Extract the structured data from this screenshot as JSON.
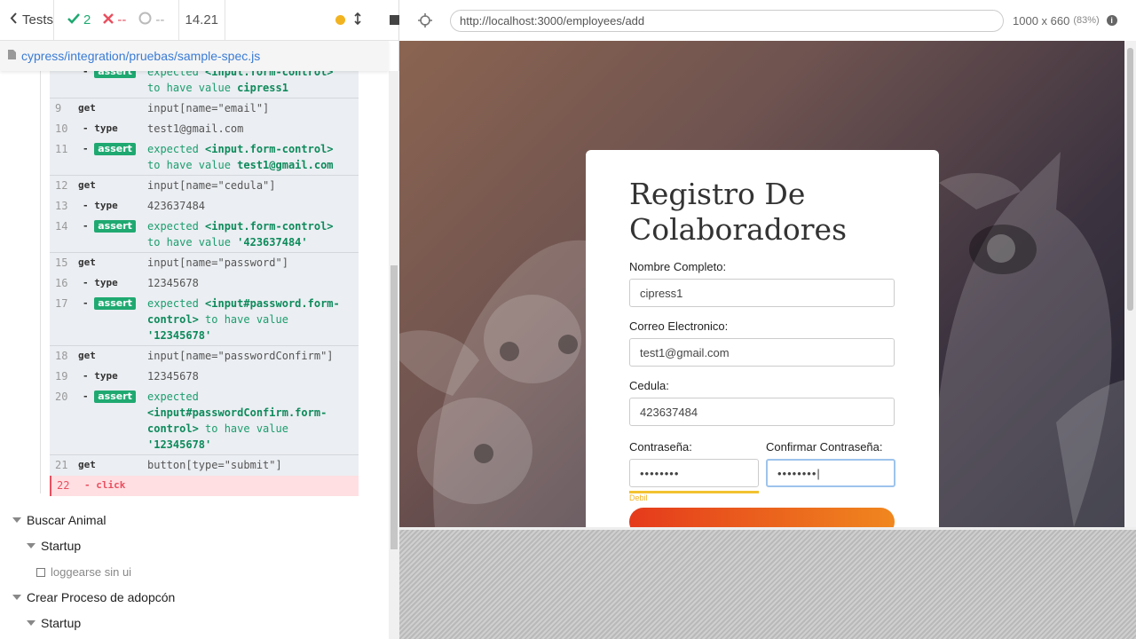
{
  "topbar": {
    "tests_label": "Tests",
    "passed": "2",
    "failed": "--",
    "pending": "--",
    "duration": "14.21"
  },
  "spec": {
    "file": "cypress/integration/pruebas/sample-spec.js"
  },
  "commands": [
    {
      "num": "",
      "name": "- assert",
      "badge": true,
      "msg_html": "<span class='g'>expected</span> <span class='gb'>&lt;input.form-control&gt;</span><br><span class='g'>to have value</span> <span class='gb'>cipress1</span>"
    },
    {
      "num": "9",
      "name": "get",
      "msg": "input[name=\"email\"]"
    },
    {
      "num": "10",
      "name": "- type",
      "msg": "test1@gmail.com"
    },
    {
      "num": "11",
      "name": "- assert",
      "badge": true,
      "expected": "<input.form-control>",
      "value": "test1@gmail.com"
    },
    {
      "num": "12",
      "name": "get",
      "msg": "input[name=\"cedula\"]"
    },
    {
      "num": "13",
      "name": "- type",
      "msg": "423637484"
    },
    {
      "num": "14",
      "name": "- assert",
      "badge": true,
      "expected": "<input.form-control>",
      "value": "'423637484'"
    },
    {
      "num": "15",
      "name": "get",
      "msg": "input[name=\"password\"]"
    },
    {
      "num": "16",
      "name": "- type",
      "msg": "12345678"
    },
    {
      "num": "17",
      "name": "- assert",
      "badge": true,
      "expected": "<input#password.form-control>",
      "value": "'12345678'"
    },
    {
      "num": "18",
      "name": "get",
      "msg": "input[name=\"passwordConfirm\"]"
    },
    {
      "num": "19",
      "name": "- type",
      "msg": "12345678"
    },
    {
      "num": "20",
      "name": "- assert",
      "badge": true,
      "expected": "<input#passwordConfirm.form-control>",
      "value": "'12345678'"
    },
    {
      "num": "21",
      "name": "get",
      "msg": "button[type=\"submit\"]"
    },
    {
      "num": "22",
      "name": "- click",
      "msg": "",
      "failed": true
    }
  ],
  "suites": {
    "buscar": "Buscar Animal",
    "startup1": "Startup",
    "test1": "loggearse sin ui",
    "crear": "Crear Proceso de adopcón",
    "startup2": "Startup"
  },
  "aut": {
    "url": "http://localhost:3000/employees/add",
    "viewport": "1000 x 660",
    "zoom": "(83%)"
  },
  "form": {
    "title": "Registro De Colaboradores",
    "nombre_label": "Nombre Completo:",
    "nombre_value": "cipress1",
    "correo_label": "Correo Electronico:",
    "correo_value": "test1@gmail.com",
    "cedula_label": "Cedula:",
    "cedula_value": "423637484",
    "pass_label": "Contraseña:",
    "pass_value": "••••••••",
    "confirm_label": "Confirmar Contraseña:",
    "confirm_value": "••••••••|",
    "strength": "Debil"
  },
  "colors": {
    "pass": "#1fa971",
    "fail": "#e94f5f",
    "accent": "#3a7bd5"
  }
}
